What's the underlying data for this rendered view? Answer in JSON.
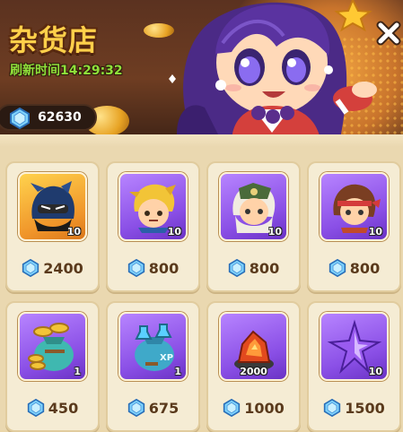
{
  "header": {
    "title": "杂货店",
    "refresh_text": "刷新时间14:29:32",
    "gem_balance": "62630",
    "close_icon": "close-icon"
  },
  "colors": {
    "title": "#ffd04a",
    "refresh": "#8fe03a",
    "card_bg": "#f5ecd4",
    "price": "#5a3a1c"
  },
  "shop": {
    "items": [
      {
        "icon": "ninja-character-icon",
        "frame": "orange",
        "quantity": "10",
        "price": "2400"
      },
      {
        "icon": "blond-character-icon",
        "frame": "purple",
        "quantity": "10",
        "price": "800"
      },
      {
        "icon": "white-hair-character-icon",
        "frame": "purple",
        "quantity": "10",
        "price": "800"
      },
      {
        "icon": "headband-character-icon",
        "frame": "purple",
        "quantity": "10",
        "price": "800"
      },
      {
        "icon": "gold-coin-bag-icon",
        "frame": "purple",
        "quantity": "1",
        "price": "450"
      },
      {
        "icon": "xp-potion-bag-icon",
        "frame": "purple",
        "quantity": "1",
        "price": "675"
      },
      {
        "icon": "fire-ore-icon",
        "frame": "purple",
        "quantity": "2000",
        "price": "1000"
      },
      {
        "icon": "purple-star-shard-icon",
        "frame": "purple",
        "quantity": "10",
        "price": "1500"
      }
    ]
  }
}
